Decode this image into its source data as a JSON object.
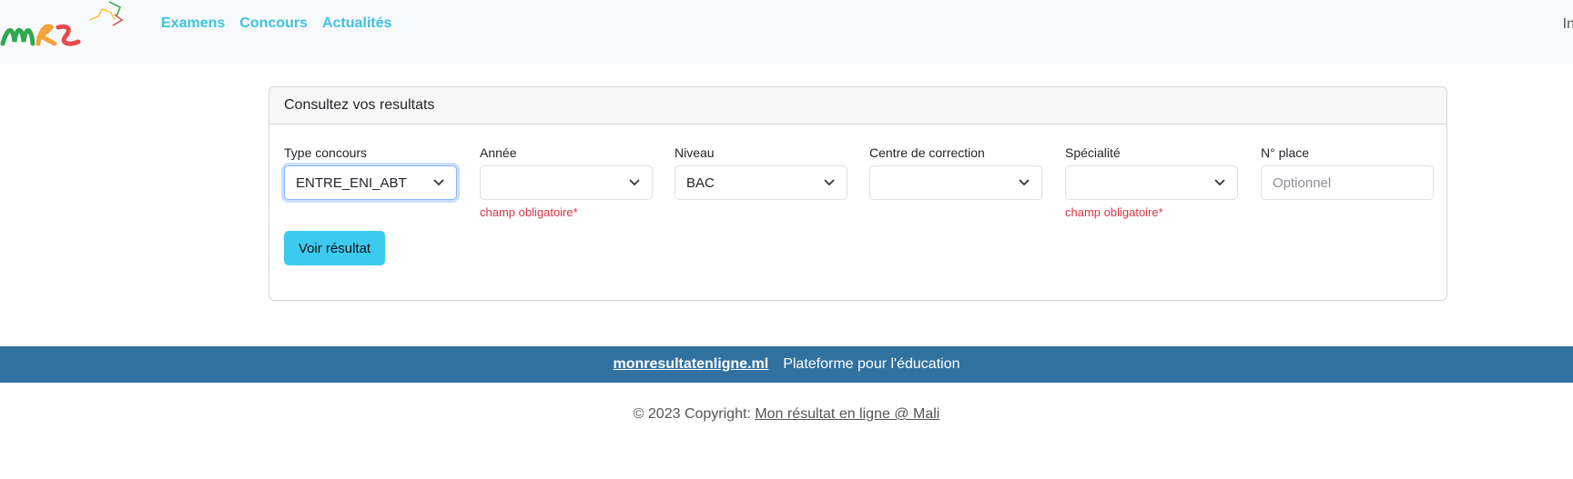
{
  "nav": {
    "links": [
      "Examens",
      "Concours",
      "Actualités"
    ],
    "right_partial": "In"
  },
  "card": {
    "title": "Consultez vos resultats",
    "fields": [
      {
        "label": "Type concours",
        "value": "ENTRE_ENI_ABT",
        "kind": "select",
        "focused": true
      },
      {
        "label": "Année",
        "value": "",
        "kind": "select",
        "error": "champ obligatoire*"
      },
      {
        "label": "Niveau",
        "value": "BAC",
        "kind": "select"
      },
      {
        "label": "Centre de correction",
        "value": "",
        "kind": "select"
      },
      {
        "label": "Spécialité",
        "value": "",
        "kind": "select",
        "error": "champ obligatoire*"
      },
      {
        "label": "N° place",
        "placeholder": "Optionnel",
        "kind": "input"
      }
    ],
    "submit_label": "Voir résultat"
  },
  "footer": {
    "site": "monresultatenligne.ml",
    "tagline": "Plateforme pour l'éducation",
    "copyright_prefix": "© 2023 Copyright:",
    "copyright_link": "Mon résultat en ligne @ Mali"
  },
  "colors": {
    "nav_link": "#3ec2e3",
    "button": "#3ccbee",
    "footer_bar": "#3171a0",
    "error": "#dc3545"
  }
}
